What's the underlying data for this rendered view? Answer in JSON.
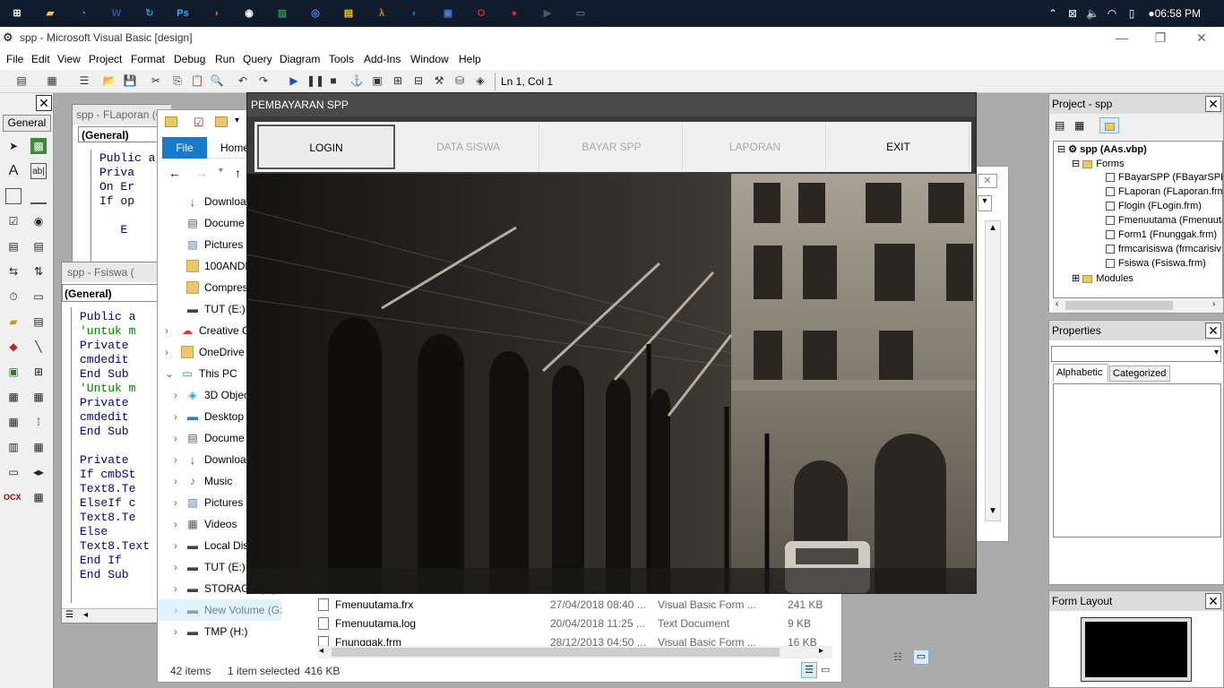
{
  "taskbar": {
    "apps": [
      "windows-icon",
      "file-explorer-icon",
      "search-app-icon",
      "word-icon",
      "sync-icon",
      "photoshop-icon",
      "paint-icon",
      "obs-icon",
      "chart-app-icon",
      "chrome-icon",
      "notes-icon",
      "lambda-icon",
      "edge-icon",
      "remote-icon",
      "opera-icon",
      "record-icon",
      "cmd-icon",
      "vb-icon"
    ],
    "clock": "06:58 PM"
  },
  "vb_window": {
    "title": "spp - Microsoft Visual Basic [design]",
    "menu": [
      "File",
      "Edit",
      "View",
      "Project",
      "Format",
      "Debug",
      "Run",
      "Query",
      "Diagram",
      "Tools",
      "Add-Ins",
      "Window",
      "Help"
    ],
    "position": "Ln 1, Col 1"
  },
  "toolbox": {
    "general_label": "General"
  },
  "code_window_1": {
    "title": "spp - FLaporan (Code)",
    "object": "(General)",
    "lines": [
      "Public a",
      "Priva",
      "On Er",
      "If op",
      "   ",
      "   E"
    ]
  },
  "code_window_2": {
    "title": "spp - Fsiswa (",
    "object": "(General)",
    "lines": [
      {
        "text": "Public a",
        "green": false
      },
      {
        "text": "'untuk m",
        "green": true
      },
      {
        "text": "Private",
        "green": false
      },
      {
        "text": "cmdedit",
        "green": false
      },
      {
        "text": "End Sub",
        "green": false
      },
      {
        "text": "'Untuk m",
        "green": true
      },
      {
        "text": "Private",
        "green": false
      },
      {
        "text": "cmdedit",
        "green": false
      },
      {
        "text": "End Sub",
        "green": false
      },
      {
        "text": "",
        "green": false
      },
      {
        "text": "Private",
        "green": false
      },
      {
        "text": "If cmbSt",
        "green": false
      },
      {
        "text": "Text8.Te",
        "green": false
      },
      {
        "text": "ElseIf c",
        "green": false
      },
      {
        "text": "Text8.Te",
        "green": false
      },
      {
        "text": "Else",
        "green": false
      },
      {
        "text": "Text8.Text",
        "green": false
      },
      {
        "text": "End If",
        "green": false
      },
      {
        "text": "End Sub",
        "green": false
      }
    ]
  },
  "explorer": {
    "ribbon_file": "File",
    "ribbon_home": "Home",
    "nav_items": [
      {
        "label": "Downloa",
        "icon": "download-icon",
        "indent": 1
      },
      {
        "label": "Docume",
        "icon": "document-icon",
        "indent": 1
      },
      {
        "label": "Pictures",
        "icon": "pictures-icon",
        "indent": 1
      },
      {
        "label": "100ANDR",
        "icon": "folder-icon",
        "indent": 1
      },
      {
        "label": "Compres",
        "icon": "folder-icon",
        "indent": 1
      },
      {
        "label": "TUT (E:)",
        "icon": "drive-icon",
        "indent": 1
      },
      {
        "label": "Creative C",
        "icon": "creative-cloud-icon",
        "indent": 0
      },
      {
        "label": "OneDrive",
        "icon": "folder-icon",
        "indent": 0
      },
      {
        "label": "This PC",
        "icon": "pc-icon",
        "indent": 0
      },
      {
        "label": "3D Objec",
        "icon": "3d-objects-icon",
        "indent": 1
      },
      {
        "label": "Desktop",
        "icon": "desktop-icon",
        "indent": 1
      },
      {
        "label": "Docume",
        "icon": "document-icon",
        "indent": 1
      },
      {
        "label": "Downloa",
        "icon": "download-icon",
        "indent": 1
      },
      {
        "label": "Music",
        "icon": "music-icon",
        "indent": 1
      },
      {
        "label": "Pictures",
        "icon": "pictures-icon",
        "indent": 1
      },
      {
        "label": "Videos",
        "icon": "videos-icon",
        "indent": 1
      },
      {
        "label": "Local Dis",
        "icon": "drive-icon",
        "indent": 1
      },
      {
        "label": "TUT (E:)",
        "icon": "drive-icon",
        "indent": 1
      },
      {
        "label": "STORAGE (F:)",
        "icon": "drive-icon",
        "indent": 1
      },
      {
        "label": "New Volume (G:",
        "icon": "drive-icon",
        "indent": 1
      },
      {
        "label": "TMP (H:)",
        "icon": "drive-icon",
        "indent": 1
      }
    ],
    "files": [
      {
        "name": "Fmenuutama.frx",
        "date": "27/04/2018 08:40 ...",
        "type": "Visual Basic Form ...",
        "size": "241 KB"
      },
      {
        "name": "Fmenuutama.log",
        "date": "20/04/2018 11:25 ...",
        "type": "Text Document",
        "size": "9 KB"
      },
      {
        "name": "Fnunggak.frm",
        "date": "28/12/2013 04:50 ...",
        "type": "Visual Basic Form ...",
        "size": "16 KB"
      }
    ],
    "status_items": "42 items",
    "status_selected": "1 item selected",
    "status_size": "416 KB"
  },
  "dialog": {
    "title": "PEMBAYARAN SPP",
    "tabs": [
      {
        "label": "LOGIN",
        "enabled": true,
        "selected": true
      },
      {
        "label": "DATA SISWA",
        "enabled": false,
        "selected": false
      },
      {
        "label": "BAYAR SPP",
        "enabled": false,
        "selected": false
      },
      {
        "label": "LAPORAN",
        "enabled": false,
        "selected": false
      },
      {
        "label": "EXIT",
        "enabled": true,
        "selected": false
      }
    ]
  },
  "project_panel": {
    "title": "Project - spp",
    "root": "spp (AAs.vbp)",
    "forms_label": "Forms",
    "forms": [
      "FBayarSPP (FBayarSPP",
      "FLaporan (FLaporan.frm",
      "Flogin (FLogin.frm)",
      "Fmenuutama (Fmenuuta",
      "Form1 (Fnunggak.frm)",
      "frmcarisiswa (frmcarisiv",
      "Fsiswa (Fsiswa.frm)"
    ],
    "modules_label": "Modules"
  },
  "properties_panel": {
    "title": "Properties",
    "tab_alphabetic": "Alphabetic",
    "tab_categorized": "Categorized"
  },
  "form_layout_panel": {
    "title": "Form Layout"
  }
}
